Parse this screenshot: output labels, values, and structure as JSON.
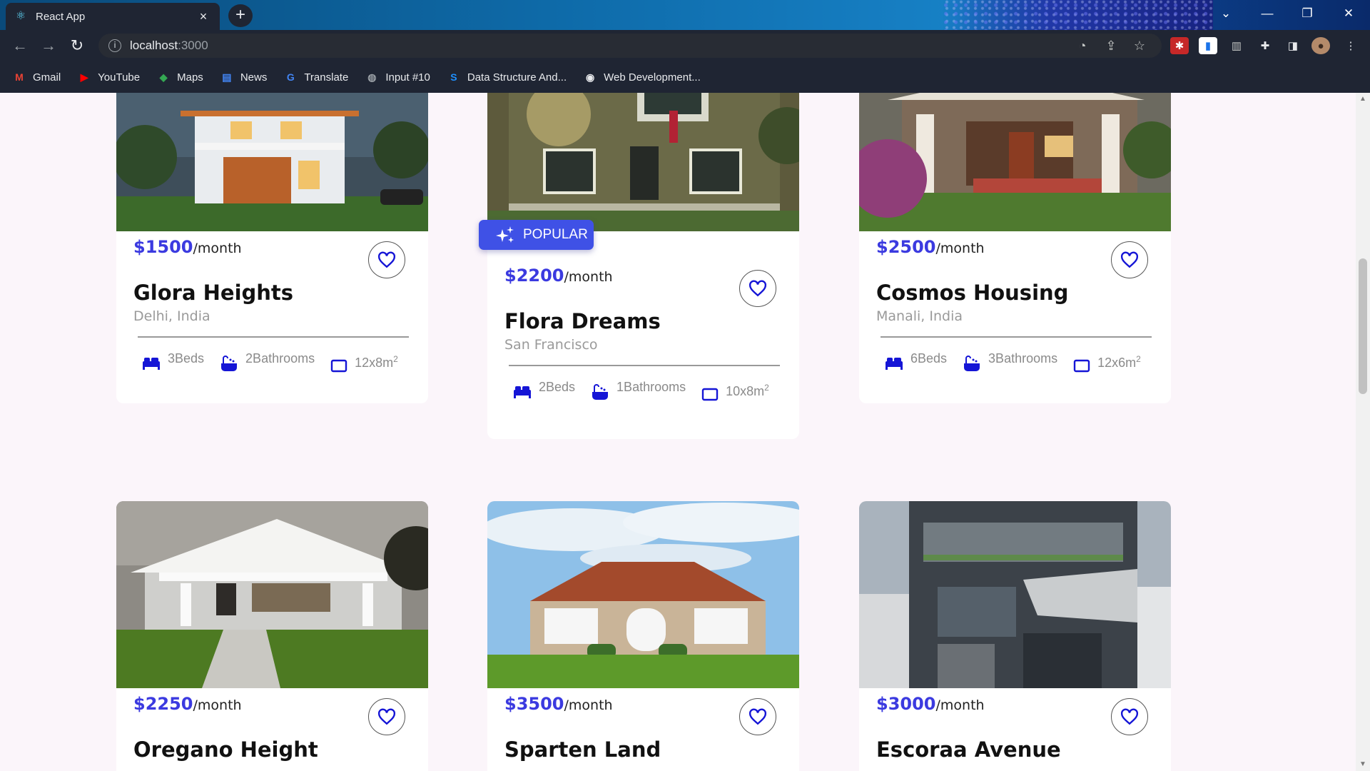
{
  "browser": {
    "tab_title": "React App",
    "tab_close": "×",
    "new_tab": "+",
    "url_host": "localhost",
    "url_port": ":3000"
  },
  "bookmarks": [
    {
      "label": "Gmail",
      "icon": "gmail-icon",
      "glyph": "M",
      "color": "#ea4335"
    },
    {
      "label": "YouTube",
      "icon": "youtube-icon",
      "glyph": "▶",
      "color": "#ff0000"
    },
    {
      "label": "Maps",
      "icon": "maps-icon",
      "glyph": "◆",
      "color": "#34a853"
    },
    {
      "label": "News",
      "icon": "news-icon",
      "glyph": "▤",
      "color": "#4285f4"
    },
    {
      "label": "Translate",
      "icon": "translate-icon",
      "glyph": "G",
      "color": "#4285f4"
    },
    {
      "label": "Input #10",
      "icon": "globe-icon",
      "glyph": "◍",
      "color": "#9aa0a6"
    },
    {
      "label": "Data Structure And...",
      "icon": "s-logo-icon",
      "glyph": "S",
      "color": "#1e90ff"
    },
    {
      "label": "Web Development...",
      "icon": "web-dev-icon",
      "glyph": "◉",
      "color": "#e8eaed"
    }
  ],
  "listings": [
    {
      "price": "$1500",
      "per": "/month",
      "name": "Glora Heights",
      "location": "Delhi, India",
      "beds": "3Beds",
      "baths": "2Bathrooms",
      "area": "12x8m",
      "area_exp": "2",
      "popular": false
    },
    {
      "price": "$2200",
      "per": "/month",
      "name": "Flora Dreams",
      "location": "San Francisco",
      "beds": "2Beds",
      "baths": "1Bathrooms",
      "area": "10x8m",
      "area_exp": "2",
      "popular": true,
      "badge": "POPULAR"
    },
    {
      "price": "$2500",
      "per": "/month",
      "name": "Cosmos Housing",
      "location": "Manali, India",
      "beds": "6Beds",
      "baths": "3Bathrooms",
      "area": "12x6m",
      "area_exp": "2",
      "popular": false
    },
    {
      "price": "$2250",
      "per": "/month",
      "name": "Oregano Height"
    },
    {
      "price": "$3500",
      "per": "/month",
      "name": "Sparten Land"
    },
    {
      "price": "$3000",
      "per": "/month",
      "name": "Escoraa Avenue"
    }
  ],
  "colors": {
    "accent": "#3b3ae0",
    "badge": "#3f51e6",
    "icon_blue": "#1515d6"
  }
}
